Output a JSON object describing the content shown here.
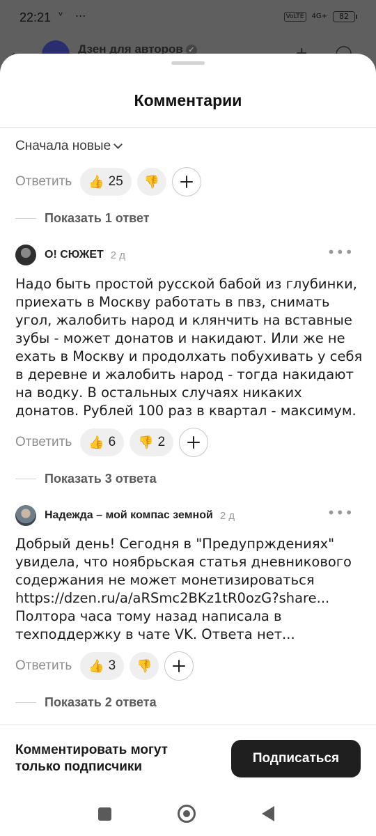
{
  "status_bar": {
    "time": "22:21",
    "left_icons": "ᵛ ⋯",
    "volte": "VoLTE",
    "network": "4G+",
    "battery": "82"
  },
  "background_app": {
    "channel_name": "Дзен для авторов"
  },
  "sheet": {
    "title": "Комментарии",
    "sort_label": "Сначала новые"
  },
  "comments": [
    {
      "reply_label": "Ответить",
      "likes": "25",
      "dislikes": "",
      "show_replies": "Показать 1 ответ"
    },
    {
      "author": "О! СЮЖЕТ",
      "time": "2 д",
      "text": "Надо быть простой русской бабой из глубинки, приехать в Москву работать в пвз, снимать угол, жалобить народ и клянчить на вставные зубы - может донатов и накидают. Или же не ехать в Москву и продолхать побухивать у себя в деревне и жалобить народ - тогда накидают на водку. В остальных случаях никаких донатов. Рублей 100 раз в квартал - максимум.",
      "reply_label": "Ответить",
      "likes": "6",
      "dislikes": "2",
      "show_replies": "Показать 3 ответа"
    },
    {
      "author": "Надежда – мой компас земной",
      "time": "2 д",
      "text": "Добрый день! Сегодня в \"Предупрждениях\" увидела, что  ноябрьская статья дневникового содержания не может монетизироваться https://dzen.ru/a/aRSmc2BKz1tR0ozG?share...\nПолтора часа тому назад написала в техподдержку в чате VK. Ответа нет...",
      "reply_label": "Ответить",
      "likes": "3",
      "dislikes": "",
      "show_replies": "Показать 2 ответа"
    }
  ],
  "footer": {
    "notice": "Комментировать могут только подписчики",
    "subscribe_label": "Подписаться"
  },
  "icons": {
    "like": "thumbs-up-icon",
    "dislike": "thumbs-down-icon",
    "add_reaction": "plus-icon",
    "more": "more-dots-icon"
  }
}
